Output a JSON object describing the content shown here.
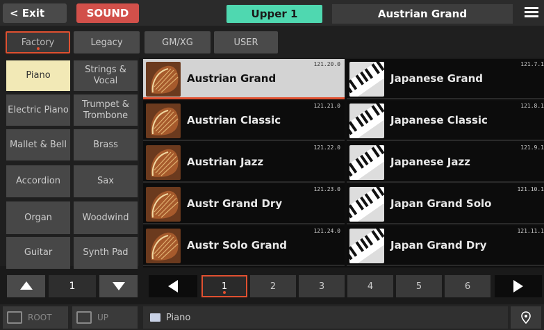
{
  "topbar": {
    "exit_label": "< Exit",
    "mode_label": "SOUND",
    "keyboard_part": "Upper 1",
    "current_sound": "Austrian Grand"
  },
  "banks": [
    {
      "label": "Factory",
      "active": true
    },
    {
      "label": "Legacy",
      "active": false
    },
    {
      "label": "GM/XG",
      "active": false
    },
    {
      "label": "USER",
      "active": false
    }
  ],
  "categories": [
    {
      "label": "Piano",
      "active": true
    },
    {
      "label": "Strings & Vocal",
      "active": false
    },
    {
      "label": "Electric Piano",
      "active": false
    },
    {
      "label": "Trumpet & Trombone",
      "active": false
    },
    {
      "label": "Mallet & Bell",
      "active": false
    },
    {
      "label": "Brass",
      "active": false
    },
    {
      "label": "Accordion",
      "active": false
    },
    {
      "label": "Sax",
      "active": false
    },
    {
      "label": "Organ",
      "active": false
    },
    {
      "label": "Woodwind",
      "active": false
    },
    {
      "label": "Guitar",
      "active": false
    },
    {
      "label": "Synth Pad",
      "active": false
    }
  ],
  "category_page": "1",
  "sounds": [
    {
      "name": "Austrian Grand",
      "number": "121.20.0",
      "selected": true,
      "thumb": "acoustic-piano-icon"
    },
    {
      "name": "Japanese Grand",
      "number": "121.7.1",
      "selected": false,
      "thumb": "piano-keys-icon"
    },
    {
      "name": "Austrian Classic",
      "number": "121.21.0",
      "selected": false,
      "thumb": "acoustic-piano-icon"
    },
    {
      "name": "Japanese Classic",
      "number": "121.8.1",
      "selected": false,
      "thumb": "piano-keys-icon"
    },
    {
      "name": "Austrian Jazz",
      "number": "121.22.0",
      "selected": false,
      "thumb": "acoustic-piano-icon"
    },
    {
      "name": "Japanese Jazz",
      "number": "121.9.1",
      "selected": false,
      "thumb": "piano-keys-icon"
    },
    {
      "name": "Austr Grand Dry",
      "number": "121.23.0",
      "selected": false,
      "thumb": "acoustic-piano-icon"
    },
    {
      "name": "Japan Grand Solo",
      "number": "121.10.1",
      "selected": false,
      "thumb": "piano-keys-icon"
    },
    {
      "name": "Austr Solo Grand",
      "number": "121.24.0",
      "selected": false,
      "thumb": "acoustic-piano-icon"
    },
    {
      "name": "Japan Grand Dry",
      "number": "121.11.1",
      "selected": false,
      "thumb": "piano-keys-icon"
    }
  ],
  "pages": [
    "1",
    "2",
    "3",
    "4",
    "5",
    "6"
  ],
  "active_page": "1",
  "bottombar": {
    "root_label": "ROOT",
    "up_label": "UP",
    "path": "Piano"
  },
  "colors": {
    "accent": "#e05030",
    "sound_tab": "#d2504a",
    "part_tab": "#4fd8b0",
    "category_active": "#f2e9b6"
  }
}
